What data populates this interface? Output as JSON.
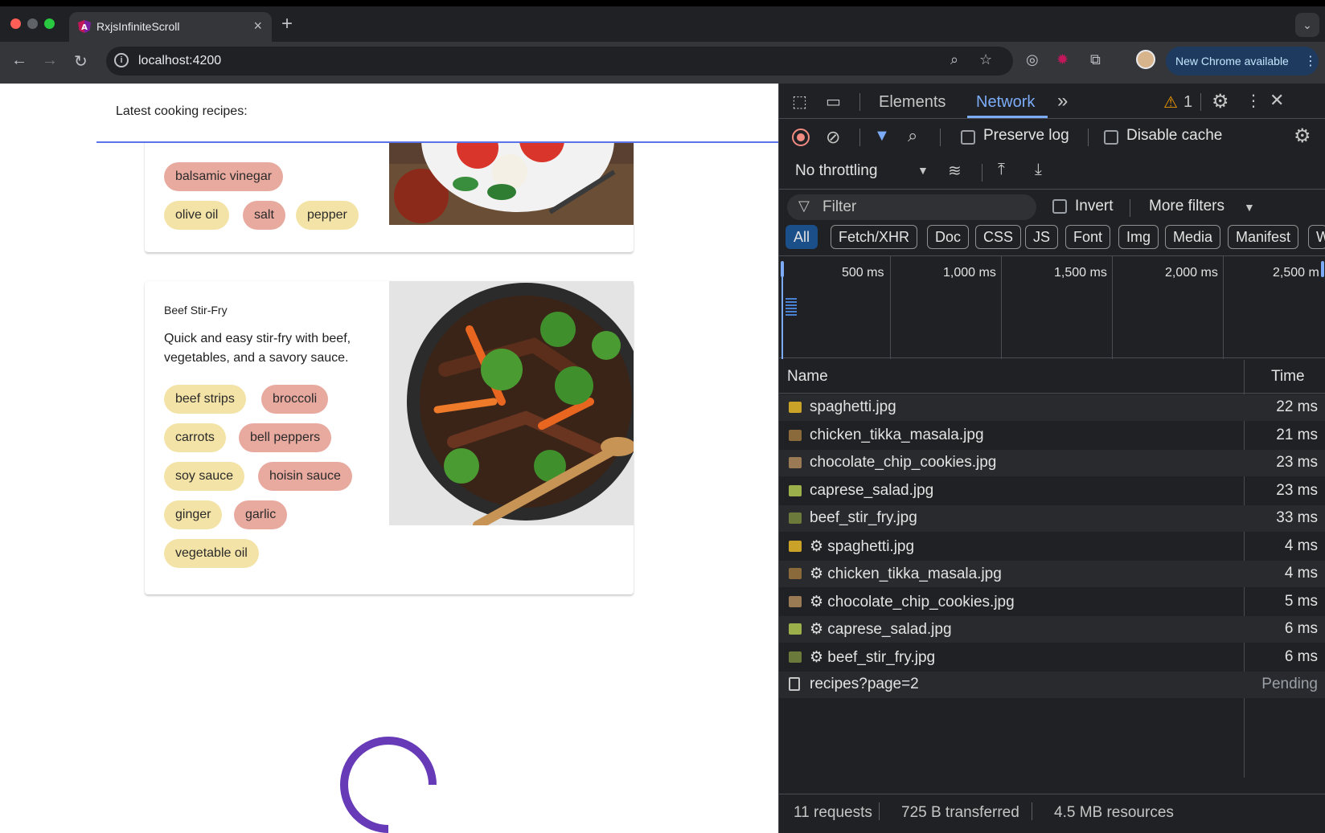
{
  "browser": {
    "tab_title": "RxjsInfiniteScroll",
    "tab_close": "×",
    "new_tab": "+",
    "url": "localhost:4200",
    "new_chrome_label": "New Chrome available",
    "menu_dots": "⋮"
  },
  "page": {
    "header_title": "Latest cooking recipes:",
    "cards": [
      {
        "ingredients": [
          "balsamic vinegar",
          "olive oil",
          "salt",
          "pepper"
        ]
      },
      {
        "title": "Beef Stir-Fry",
        "description": "Quick and easy stir-fry with beef, vegetables, and a savory sauce.",
        "ingredients": [
          "beef strips",
          "broccoli",
          "carrots",
          "bell peppers",
          "soy sauce",
          "hoisin sauce",
          "ginger",
          "garlic",
          "vegetable oil"
        ]
      }
    ]
  },
  "devtools": {
    "tabs": {
      "elements": "Elements",
      "network": "Network",
      "more": "»"
    },
    "warning_count": "1",
    "preserve_log": "Preserve log",
    "disable_cache": "Disable cache",
    "throttling": "No throttling",
    "filter_placeholder": "Filter",
    "invert": "Invert",
    "more_filters": "More filters",
    "type_filters": [
      "All",
      "Fetch/XHR",
      "Doc",
      "CSS",
      "JS",
      "Font",
      "Img",
      "Media",
      "Manifest",
      "W"
    ],
    "timeline_labels": [
      "500 ms",
      "1,000 ms",
      "1,500 ms",
      "2,000 ms",
      "2,500 m"
    ],
    "columns": {
      "name": "Name",
      "time": "Time"
    },
    "requests": [
      {
        "name": "spaghetti.jpg",
        "time": "22 ms",
        "cached": false,
        "type": "img"
      },
      {
        "name": "chicken_tikka_masala.jpg",
        "time": "21 ms",
        "cached": false,
        "type": "img"
      },
      {
        "name": "chocolate_chip_cookies.jpg",
        "time": "23 ms",
        "cached": false,
        "type": "img"
      },
      {
        "name": "caprese_salad.jpg",
        "time": "23 ms",
        "cached": false,
        "type": "img"
      },
      {
        "name": "beef_stir_fry.jpg",
        "time": "33 ms",
        "cached": false,
        "type": "img"
      },
      {
        "name": "⚙ spaghetti.jpg",
        "time": "4 ms",
        "cached": true,
        "type": "img"
      },
      {
        "name": "⚙ chicken_tikka_masala.jpg",
        "time": "4 ms",
        "cached": true,
        "type": "img"
      },
      {
        "name": "⚙ chocolate_chip_cookies.jpg",
        "time": "5 ms",
        "cached": true,
        "type": "img"
      },
      {
        "name": "⚙ caprese_salad.jpg",
        "time": "6 ms",
        "cached": true,
        "type": "img"
      },
      {
        "name": "⚙ beef_stir_fry.jpg",
        "time": "6 ms",
        "cached": true,
        "type": "img"
      },
      {
        "name": "recipes?page=2",
        "time": "Pending",
        "cached": false,
        "type": "doc"
      }
    ],
    "status": {
      "requests": "11 requests",
      "transferred": "725 B transferred",
      "resources": "4.5 MB resources"
    }
  },
  "colors": {
    "chip_yellow": "#f4e3a6",
    "chip_red": "#e8a99f",
    "spinner": "#673ab7",
    "network_tab_active": "#7cacf8"
  }
}
